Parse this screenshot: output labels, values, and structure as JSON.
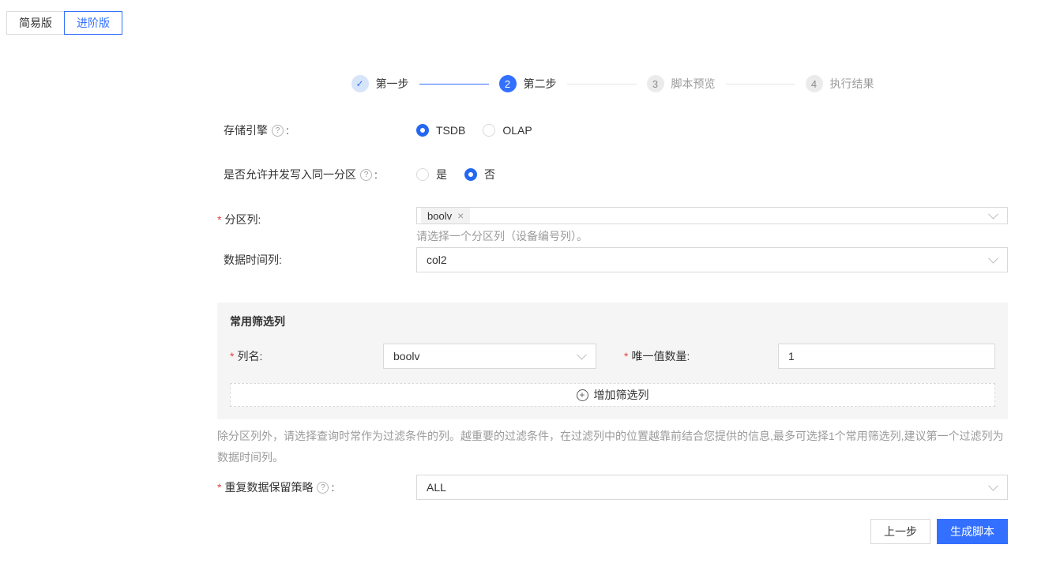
{
  "tabs": {
    "simple": "简易版",
    "advanced": "进阶版"
  },
  "stepper": [
    {
      "label": "第一步",
      "status": "done"
    },
    {
      "num": "2",
      "label": "第二步",
      "status": "active"
    },
    {
      "num": "3",
      "label": "脚本预览",
      "status": "pending"
    },
    {
      "num": "4",
      "label": "执行结果",
      "status": "pending"
    }
  ],
  "form": {
    "storage_engine": {
      "label": "存储引擎",
      "option1": "TSDB",
      "option2": "OLAP",
      "selected": "TSDB"
    },
    "concurrent_write": {
      "label": "是否允许并发写入同一分区",
      "option1": "是",
      "option2": "否",
      "selected": "否"
    },
    "partition_column": {
      "label": "分区列",
      "tag": "boolv",
      "hint": "请选择一个分区列（设备编号列）。"
    },
    "data_time_column": {
      "label": "数据时间列",
      "value": "col2"
    },
    "dedup_policy": {
      "label": "重复数据保留策略",
      "value": "ALL"
    }
  },
  "filter_panel": {
    "title": "常用筛选列",
    "column_name": {
      "label": "列名",
      "value": "boolv"
    },
    "unique_count": {
      "label": "唯一值数量",
      "value": "1"
    },
    "add_button_label": "增加筛选列",
    "description": "除分区列外，请选择查询时常作为过滤条件的列。越重要的过滤条件，在过滤列中的位置越靠前结合您提供的信息,最多可选择1个常用筛选列,建议第一个过滤列为数据时间列。"
  },
  "footer": {
    "prev_label": "上一步",
    "generate_label": "生成脚本"
  },
  "icons": {
    "check": "✓",
    "help": "?",
    "close": "×",
    "plus": "+"
  },
  "ui": {
    "colon": ":",
    "required_mark": "*"
  },
  "colors": {
    "primary": "#3370ff",
    "required_red": "#e64545",
    "panel_bg": "#f5f5f5"
  }
}
